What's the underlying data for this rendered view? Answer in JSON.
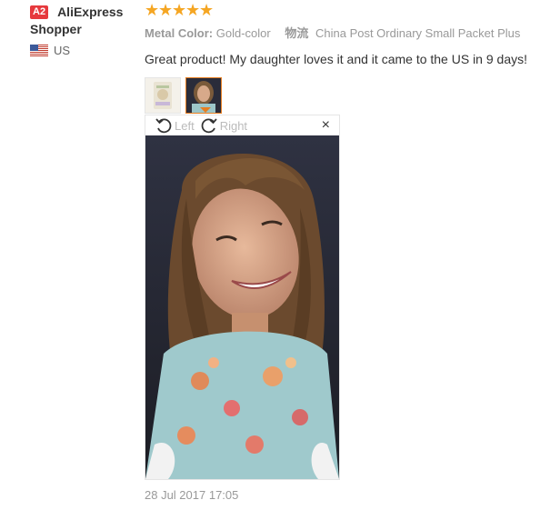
{
  "reviewer": {
    "badge": "A2",
    "name_line1": "AliExpress",
    "name_line2": "Shopper",
    "country": "US"
  },
  "review": {
    "rating": 5,
    "attrs": {
      "color_key": "Metal Color:",
      "color_value": "Gold-color",
      "shipping_key": "物流",
      "shipping_value": "China Post Ordinary Small Packet Plus"
    },
    "content": "Great product! My daughter loves it and it came to the US in 9 days!",
    "date": "28 Jul 2017 17:05"
  },
  "viewer": {
    "rotate_left_label": "Left",
    "rotate_right_label": "Right",
    "close_label": "×"
  },
  "icons": {
    "star": "star-icon",
    "flag": "us-flag-icon",
    "rotate_left": "rotate-left-icon",
    "rotate_right": "rotate-right-icon",
    "close": "close-icon"
  },
  "colors": {
    "star": "#f5a623",
    "badge": "#e6393d",
    "active_thumb": "#e67e22"
  }
}
